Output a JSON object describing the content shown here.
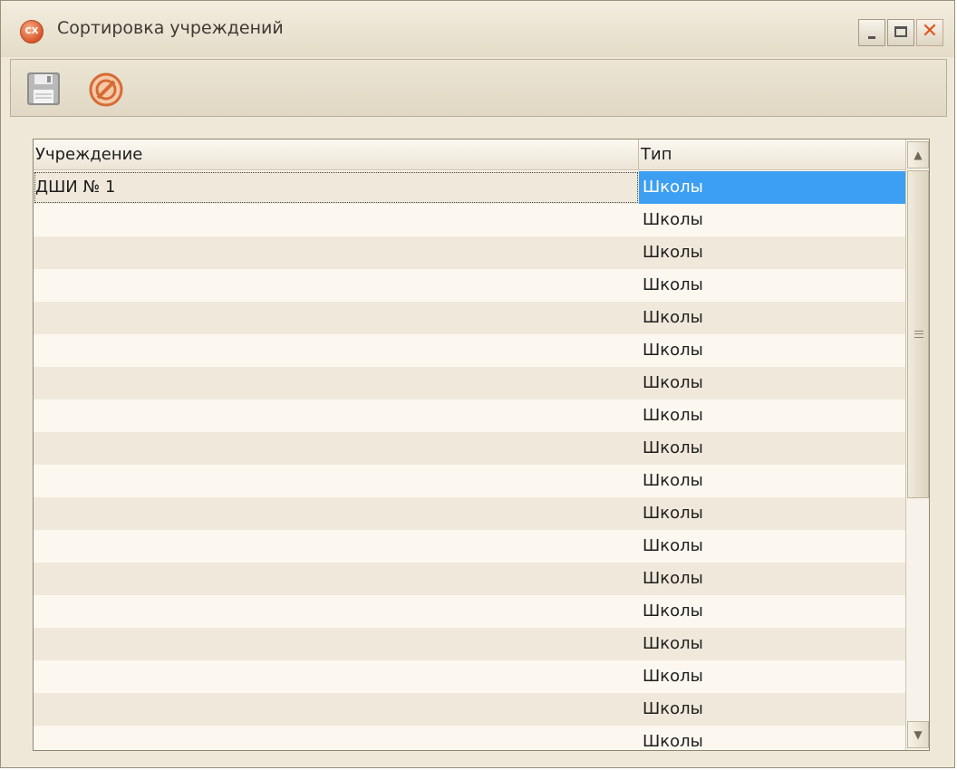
{
  "window": {
    "title": "Сортировка учреждений",
    "app_icon_text": "CX",
    "close_glyph": "✕"
  },
  "toolbar": {
    "save_icon": "floppy-disk-icon",
    "cancel_icon": "cancel-circle-icon",
    "accent_color": "#e07a45"
  },
  "grid": {
    "columns": [
      "Учреждение",
      "Тип"
    ],
    "rows": [
      {
        "institution": "ДШИ № 1",
        "type": "Школы"
      },
      {
        "institution": "",
        "type": "Школы"
      },
      {
        "institution": "",
        "type": "Школы"
      },
      {
        "institution": "",
        "type": "Школы"
      },
      {
        "institution": "",
        "type": "Школы"
      },
      {
        "institution": "",
        "type": "Школы"
      },
      {
        "institution": "",
        "type": "Школы"
      },
      {
        "institution": "",
        "type": "Школы"
      },
      {
        "institution": "",
        "type": "Школы"
      },
      {
        "institution": "",
        "type": "Школы"
      },
      {
        "institution": "",
        "type": "Школы"
      },
      {
        "institution": "",
        "type": "Школы"
      },
      {
        "institution": "",
        "type": "Школы"
      },
      {
        "institution": "",
        "type": "Школы"
      },
      {
        "institution": "",
        "type": "Школы"
      },
      {
        "institution": "",
        "type": "Школы"
      },
      {
        "institution": "",
        "type": "Школы"
      },
      {
        "institution": "",
        "type": "Школы"
      }
    ],
    "selected_color": "#3d9ff2"
  },
  "scrollbar": {
    "up_glyph": "▲",
    "down_glyph": "▼"
  }
}
